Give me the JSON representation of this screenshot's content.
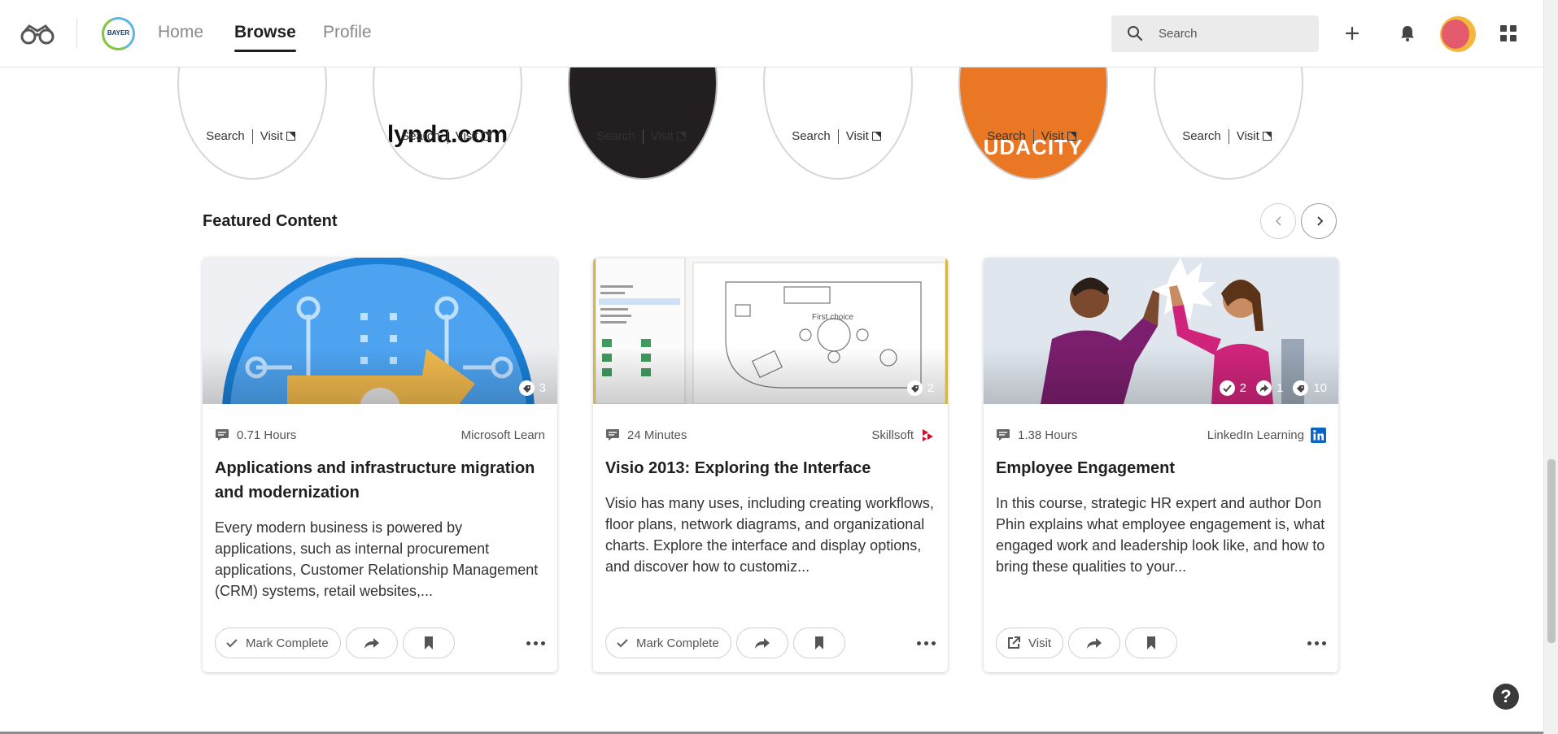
{
  "nav": {
    "links": [
      "Home",
      "Browse",
      "Profile"
    ],
    "active": "Browse",
    "brand_logo_text": "BAYER",
    "search_placeholder": "Search"
  },
  "providers": [
    {
      "logo": "",
      "search": "Search",
      "visit": "Visit"
    },
    {
      "logo": "lynda.com",
      "search": "Search",
      "visit": "Visit"
    },
    {
      "logo": "",
      "search": "Search",
      "visit": "Visit"
    },
    {
      "logo": "",
      "search": "Search",
      "visit": "Visit"
    },
    {
      "logo": "UDACITY",
      "search": "Search",
      "visit": "Visit"
    },
    {
      "logo": "",
      "search": "Search",
      "visit": "Visit"
    }
  ],
  "featured": {
    "title": "Featured Content",
    "cards": [
      {
        "stats": {
          "tags": "3"
        },
        "duration": "0.71 Hours",
        "provider": "Microsoft Learn",
        "title": "Applications and infrastructure migration and modernization",
        "description": "Every modern business is powered by applications, such as internal procurement applications, Customer Relationship Management (CRM) systems, retail websites,...",
        "primary_action": "Mark Complete"
      },
      {
        "stats": {
          "tags": "2"
        },
        "duration": "24 Minutes",
        "provider": "Skillsoft",
        "title": "Visio 2013: Exploring the Interface",
        "description": "Visio has many uses, including creating workflows, floor plans, network diagrams, and organizational charts. Explore the interface and display options, and discover how to customiz...",
        "primary_action": "Mark Complete"
      },
      {
        "stats": {
          "completed": "2",
          "shared": "1",
          "tags": "10"
        },
        "duration": "1.38 Hours",
        "provider": "LinkedIn Learning",
        "title": "Employee Engagement",
        "description": "In this course, strategic HR expert and author Don Phin explains what employee engagement is, what engaged work and leadership look like, and how to bring these qualities to your...",
        "primary_action": "Visit"
      }
    ]
  },
  "help": {
    "label": "?"
  },
  "colors": {
    "accent_dark": "#1f1f1f",
    "muted": "#8a8a8a",
    "linkedin": "#0a66c2",
    "skillsoft": "#c8102e",
    "udacity": "#ea7723"
  }
}
